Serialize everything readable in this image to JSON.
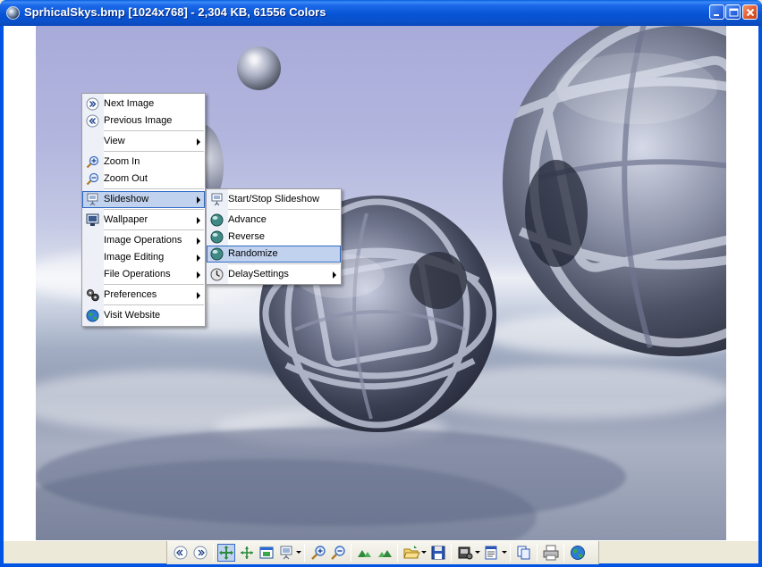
{
  "window": {
    "title": "SprhicalSkys.bmp [1024x768] - 2,304 KB, 61556 Colors"
  },
  "context_menu": {
    "items": [
      {
        "label": "Next Image",
        "icon": "next-double-chevron-icon"
      },
      {
        "label": "Previous Image",
        "icon": "previous-double-chevron-icon"
      },
      {
        "label": "View",
        "submenu": true
      },
      {
        "label": "Zoom In",
        "icon": "zoom-in-icon"
      },
      {
        "label": "Zoom Out",
        "icon": "zoom-out-icon"
      },
      {
        "label": "Slideshow",
        "icon": "slideshow-icon",
        "submenu": true,
        "highlighted": true
      },
      {
        "label": "Wallpaper",
        "icon": "wallpaper-icon",
        "submenu": true
      },
      {
        "label": "Image Operations",
        "submenu": true
      },
      {
        "label": "Image Editing",
        "submenu": true
      },
      {
        "label": "File Operations",
        "submenu": true
      },
      {
        "label": "Preferences",
        "icon": "preferences-icon",
        "submenu": true
      },
      {
        "label": "Visit Website",
        "icon": "globe-icon"
      }
    ]
  },
  "slideshow_submenu": {
    "items": [
      {
        "label": "Start/Stop Slideshow",
        "icon": "slideshow-icon"
      },
      {
        "label": "Advance",
        "icon": "advance-icon"
      },
      {
        "label": "Reverse",
        "icon": "reverse-icon"
      },
      {
        "label": "Randomize",
        "icon": "randomize-icon",
        "highlighted": true
      },
      {
        "label": "DelaySettings",
        "icon": "delay-clock-icon",
        "submenu": true
      }
    ]
  },
  "toolbar": {
    "buttons": [
      "previous-icon",
      "next-icon",
      "fit-window-icon",
      "actual-size-icon",
      "full-screen-icon",
      "slideshow-icon",
      "zoom-in-icon",
      "zoom-out-icon",
      "rotate-left-icon",
      "rotate-right-icon",
      "open-folder-icon",
      "save-icon",
      "tools-icon",
      "properties-icon",
      "copy-icon",
      "print-icon",
      "globe-icon"
    ]
  },
  "colors": {
    "titlebar": "#0a50c8",
    "menu_highlight": "#c1d2ee",
    "menu_highlight_border": "#316ac5"
  }
}
